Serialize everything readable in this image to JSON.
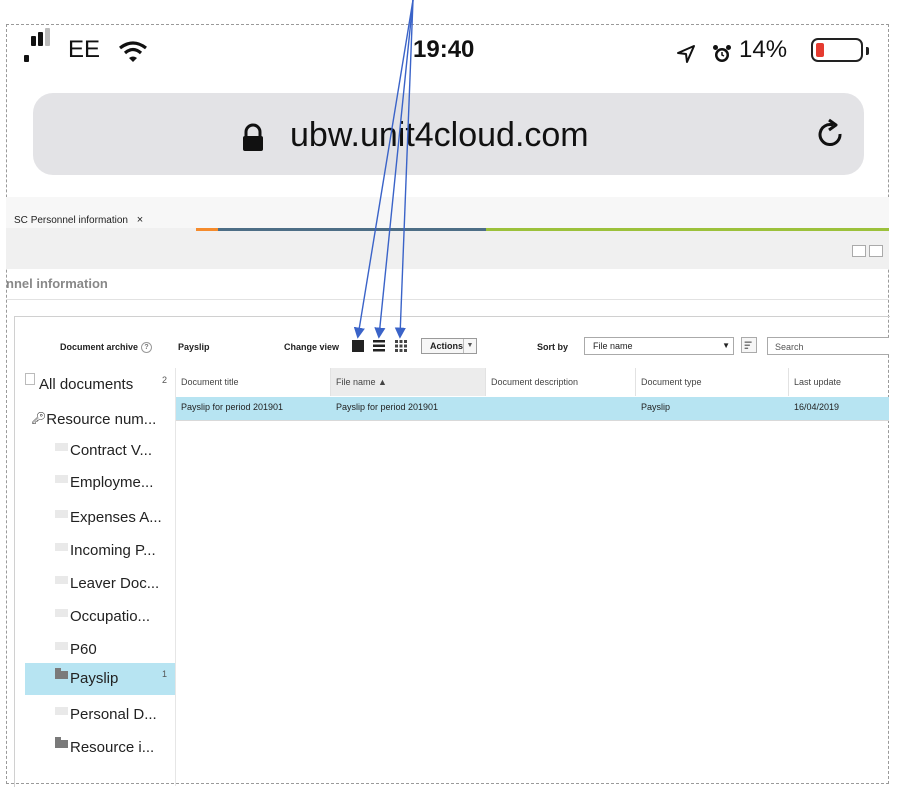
{
  "status_bar": {
    "carrier": "EE",
    "time": "19:40",
    "battery": "14%",
    "battery_level": 0.14
  },
  "browser": {
    "url": "ubw.unit4cloud.com"
  },
  "app_tab": {
    "prefix": "SC",
    "label": "Personnel information",
    "close": "×"
  },
  "page": {
    "title": "nnel information"
  },
  "toolbar": {
    "document_archive_label": "Document archive",
    "help": "?",
    "current_folder": "Payslip",
    "change_view_label": "Change view",
    "actions_label": "Actions",
    "sort_by_label": "Sort by",
    "sort_value": "File name",
    "search_placeholder": "Search"
  },
  "tree": [
    {
      "label": "All documents",
      "count": "2",
      "icon": "document-icon"
    },
    {
      "label": "Resource num...",
      "icon": "key-icon"
    },
    {
      "label": "Contract V...",
      "icon": "folder-icon"
    },
    {
      "label": "Employme...",
      "icon": "folder-icon"
    },
    {
      "label": "Expenses A...",
      "icon": "folder-icon"
    },
    {
      "label": "Incoming P...",
      "icon": "folder-icon"
    },
    {
      "label": "Leaver Doc...",
      "icon": "folder-icon"
    },
    {
      "label": "Occupatio...",
      "icon": "folder-icon"
    },
    {
      "label": "P60",
      "icon": "folder-icon"
    },
    {
      "label": "Payslip",
      "count": "1",
      "icon": "folder-icon",
      "selected": true
    },
    {
      "label": "Personal D...",
      "icon": "folder-icon"
    },
    {
      "label": "Resource i...",
      "icon": "folder-icon"
    }
  ],
  "table": {
    "columns": [
      "Document title",
      "File name ▲",
      "Document description",
      "Document type",
      "Last update"
    ],
    "rows": [
      [
        "Payslip for period 201901",
        "Payslip for period 201901",
        "",
        "Payslip",
        "16/04/2019"
      ]
    ]
  },
  "colors": {
    "selection": "#b7e4f2",
    "annotation_arrow": "#3a63c8",
    "tab_orange": "#f58b2c",
    "tab_green": "#9cc13b"
  }
}
